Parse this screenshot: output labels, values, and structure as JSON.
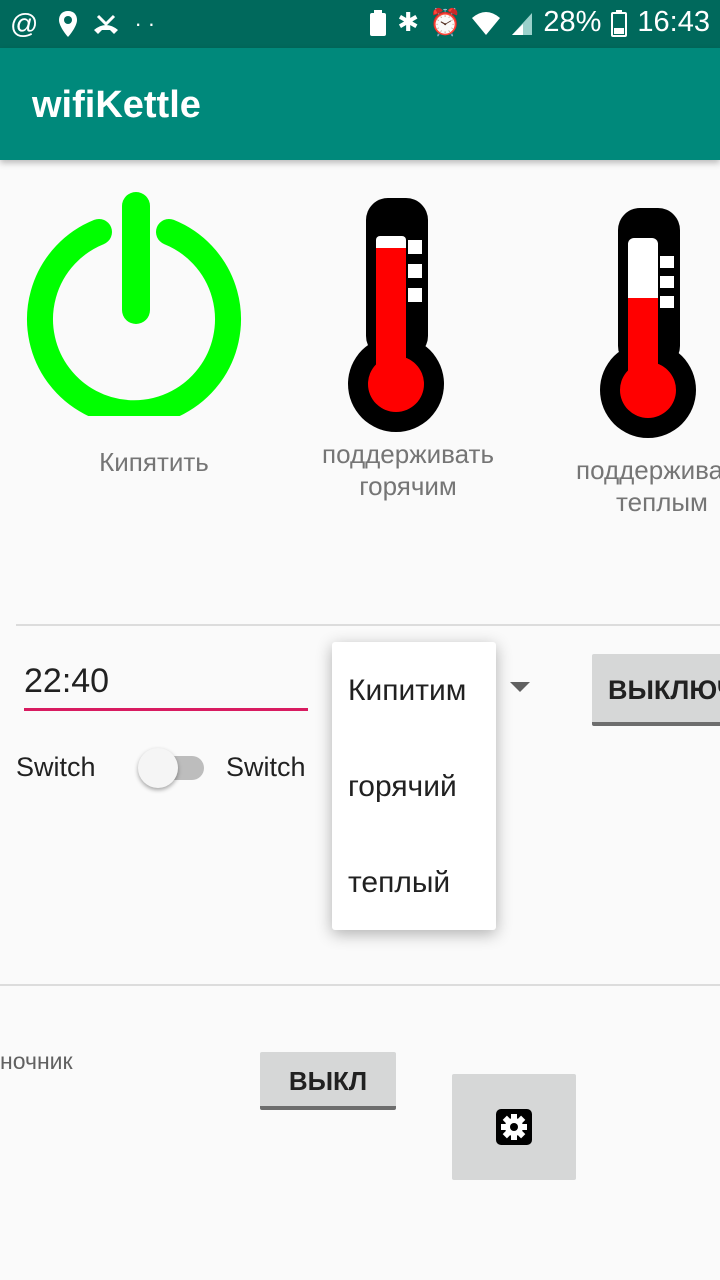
{
  "status_bar": {
    "left_icons": [
      "at-icon",
      "location-pin-icon",
      "missed-call-icon",
      "dots-icon"
    ],
    "battery_percent": "28%",
    "time": "16:43"
  },
  "app_bar": {
    "title": "wifiKettle"
  },
  "modes": [
    {
      "label": "Кипятить",
      "icon": "power-icon",
      "color": "#00ff00"
    },
    {
      "label": "поддерживать горячим",
      "icon": "thermometer-hot-icon",
      "fill_level": 0.82
    },
    {
      "label": "поддерживать теплым",
      "icon": "thermometer-warm-icon",
      "fill_level": 0.52
    }
  ],
  "timer": {
    "time_value": "22:40",
    "switch_left_label": "Switch",
    "switch_right_label": "Switch",
    "switch_on": false,
    "off_button_label": "ВЫКЛЮЧ"
  },
  "mode_dropdown": {
    "options": [
      "Кипитим",
      "горячий",
      "теплый"
    ]
  },
  "night_light": {
    "label": "ночник",
    "button_label": "ВЫКЛ"
  },
  "colors": {
    "status_bar": "#00695c",
    "app_bar": "#00897b",
    "accent": "#d81b60",
    "power_green": "#00ff00",
    "mercury_red": "#ff0000"
  }
}
